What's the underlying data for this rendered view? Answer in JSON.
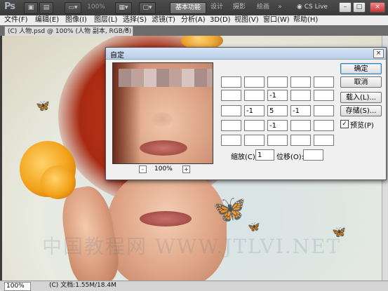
{
  "app": {
    "logo": "Ps",
    "zoom": "100%",
    "workspaces": [
      "基本功能",
      "设计",
      "摄影",
      "绘画"
    ],
    "more": "»",
    "cs_live": "CS Live",
    "window_controls": [
      "–",
      "□",
      "×"
    ]
  },
  "menu": [
    "文件(F)",
    "编辑(E)",
    "图像(I)",
    "图层(L)",
    "选择(S)",
    "滤镜(T)",
    "分析(A)",
    "3D(D)",
    "视图(V)",
    "窗口(W)",
    "帮助(H)"
  ],
  "document": {
    "tab_title": "(C) 人物.psd @ 100% (人物 副本, RGB/8) *",
    "tab_close": "×"
  },
  "status": {
    "zoom": "100%",
    "doc_info": "(C) 文档:1.55M/18.4M"
  },
  "dialog": {
    "title": "自定",
    "close": "×",
    "preview_zoom": "100%",
    "zoom_out": "-",
    "zoom_in": "+",
    "matrix": [
      [
        "",
        "",
        "",
        "",
        ""
      ],
      [
        "",
        "",
        "-1",
        "",
        ""
      ],
      [
        "",
        "-1",
        "5",
        "-1",
        ""
      ],
      [
        "",
        "",
        "-1",
        "",
        ""
      ],
      [
        "",
        "",
        "",
        "",
        ""
      ]
    ],
    "scale_label": "缩放(C):",
    "scale_value": "1",
    "offset_label": "位移(O):",
    "offset_value": "",
    "buttons": {
      "ok": "确定",
      "cancel": "取消",
      "load": "载入(L)...",
      "save": "存储(S)..."
    },
    "preview_label": "预览(P)",
    "preview_checked": true
  },
  "watermark": "中国教程网 WWW.JTLVI.NET",
  "colors": {
    "appbar": "#3a3a3a",
    "dialog_title": "#b9cde8",
    "ok_border": "#3c7fb1"
  }
}
